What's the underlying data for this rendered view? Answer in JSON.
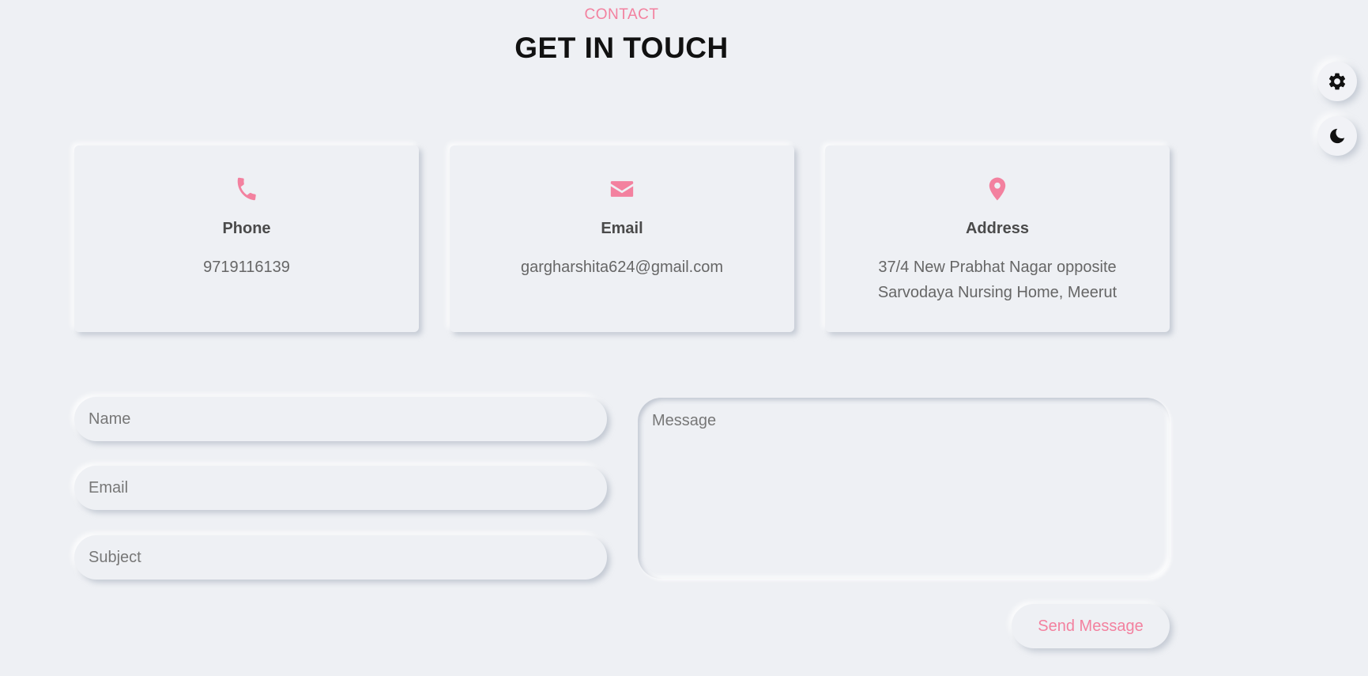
{
  "header": {
    "subtitle": "CONTACT",
    "title": "GET IN TOUCH"
  },
  "side_controls": {
    "settings_icon": "gear-icon",
    "theme_icon": "moon-icon"
  },
  "colors": {
    "accent": "#f3819f",
    "background": "#eef0f4"
  },
  "cards": [
    {
      "icon": "phone-icon",
      "title": "Phone",
      "value": "9719116139"
    },
    {
      "icon": "envelope-icon",
      "title": "Email",
      "value": "gargharshita624@gmail.com"
    },
    {
      "icon": "map-pin-icon",
      "title": "Address",
      "value": "37/4 New Prabhat Nagar opposite Sarvodaya Nursing Home, Meerut"
    }
  ],
  "form": {
    "name_placeholder": "Name",
    "email_placeholder": "Email",
    "subject_placeholder": "Subject",
    "message_placeholder": "Message",
    "submit_label": "Send Message"
  }
}
